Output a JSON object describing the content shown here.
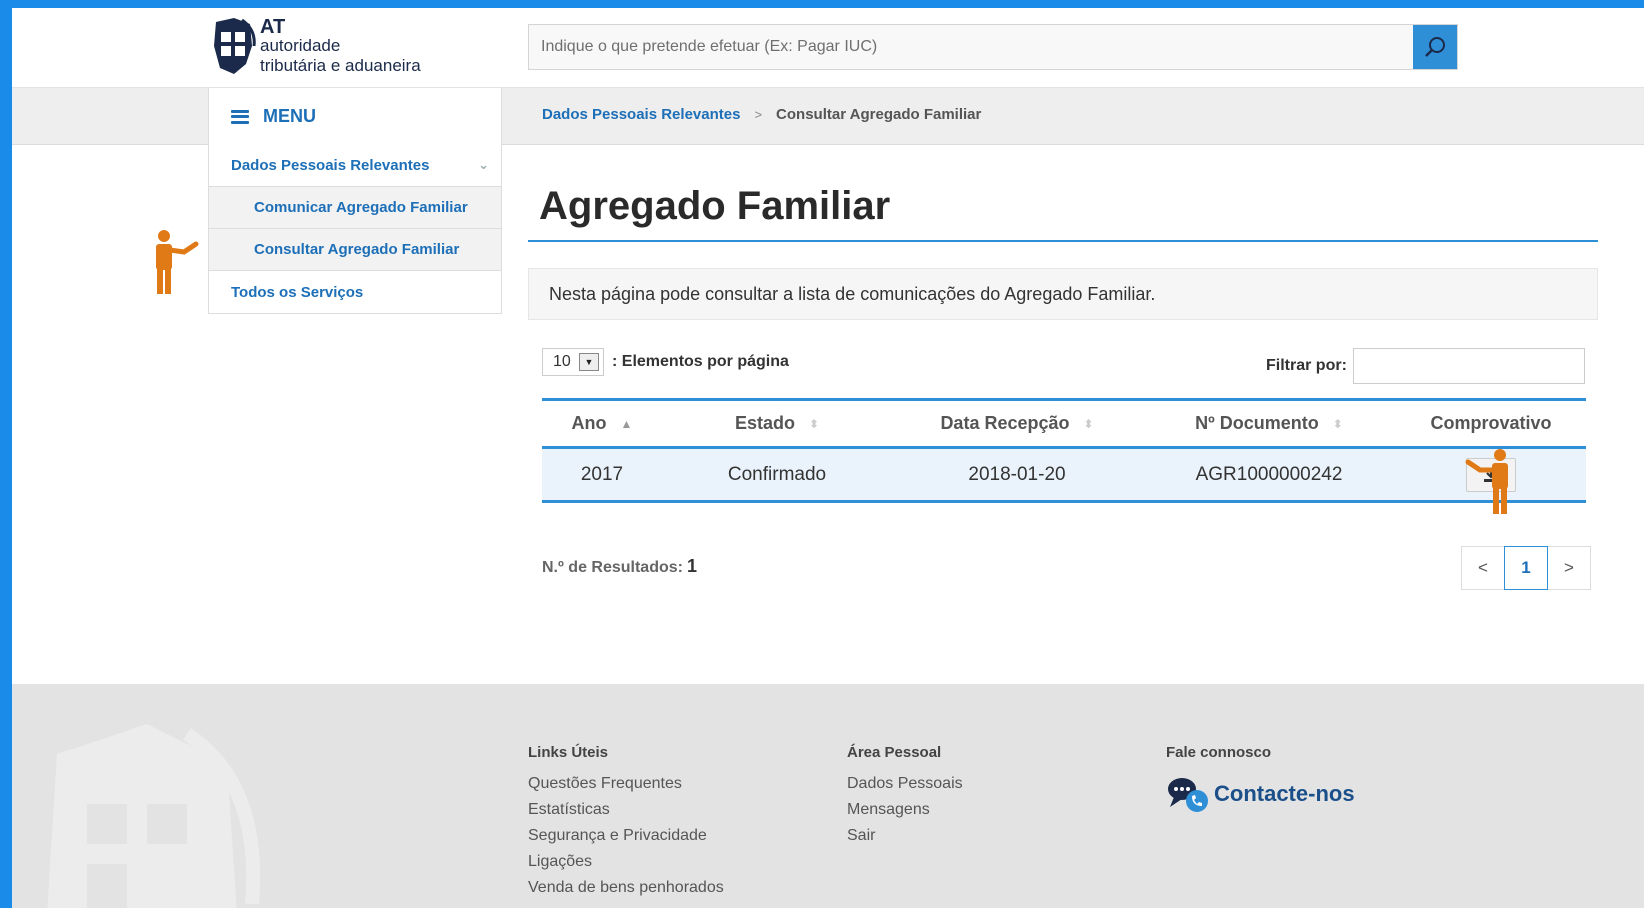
{
  "header": {
    "logo": {
      "line1": "AT",
      "line2": "autoridade",
      "line3": "tributária e aduaneira"
    },
    "search_placeholder": "Indique o que pretende efetuar (Ex: Pagar IUC)"
  },
  "menu": {
    "label": "MENU"
  },
  "breadcrumb": {
    "parent": "Dados Pessoais Relevantes",
    "separator": ">",
    "current": "Consultar Agregado Familiar"
  },
  "sidebar": {
    "items": [
      {
        "label": "Dados Pessoais Relevantes",
        "level": 1
      },
      {
        "label": "Comunicar Agregado Familiar",
        "level": 2
      },
      {
        "label": "Consultar Agregado Familiar",
        "level": 2
      },
      {
        "label": "Todos os Serviços",
        "level": 1
      }
    ]
  },
  "main": {
    "title": "Agregado Familiar",
    "info": "Nesta página pode consultar a lista de comunicações do Agregado Familiar.",
    "per_page_value": "10",
    "per_page_label": ": Elementos por página",
    "filter_label": "Filtrar por:",
    "table": {
      "headers": [
        "Ano",
        "Estado",
        "Data Recepção",
        "Nº Documento",
        "Comprovativo"
      ],
      "rows": [
        [
          "2017",
          "Confirmado",
          "2018-01-20",
          "AGR1000000242"
        ]
      ]
    },
    "results_label": "N.º de Resultados:",
    "results_count": "1",
    "pager": {
      "prev": "<",
      "current": "1",
      "next": ">"
    }
  },
  "footer": {
    "col1": {
      "title": "Links Úteis",
      "links": [
        "Questões Frequentes",
        "Estatísticas",
        "Segurança e Privacidade",
        "Ligações",
        "Venda de bens penhorados"
      ]
    },
    "col2": {
      "title": "Área Pessoal",
      "links": [
        "Dados Pessoais",
        "Mensagens",
        "Sair"
      ]
    },
    "col3": {
      "title": "Fale connosco",
      "contact_label": "Contacte-nos"
    }
  },
  "colors": {
    "accent": "#2e8fd6",
    "link": "#1d6fb8",
    "pointer_figure": "#e07a17",
    "frame": "#1a8be8"
  }
}
